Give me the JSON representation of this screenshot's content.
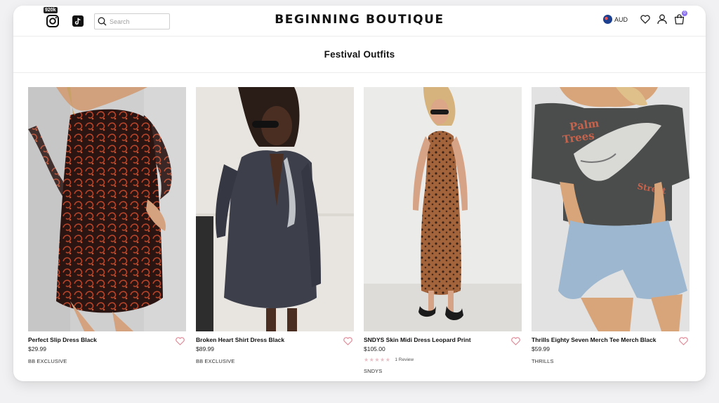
{
  "header": {
    "instagram_count": "920k",
    "search_placeholder": "Search",
    "logo": "BEGINNING BOUTIQUE",
    "currency": "AUD",
    "cart_count": "0"
  },
  "collection": {
    "title": "Festival Outfits"
  },
  "products": [
    {
      "name": "Perfect Slip Dress Black",
      "price": "$29.99",
      "brand": "BB EXCLUSIVE"
    },
    {
      "name": "Broken Heart Shirt Dress Black",
      "price": "$89.99",
      "brand": "BB EXCLUSIVE"
    },
    {
      "name": "SNDYS Skin Midi Dress Leopard Print",
      "price": "$105.00",
      "rating": 5,
      "reviews": "1 Review",
      "brand": "SNDYS"
    },
    {
      "name": "Thrills Eighty Seven Merch Tee Merch Black",
      "price": "$59.99",
      "brand": "THRILLS"
    }
  ],
  "colors": {
    "accent": "#8a6ff0",
    "wishlist_heart": "#e28a98",
    "stars": "#e8bfc6"
  }
}
